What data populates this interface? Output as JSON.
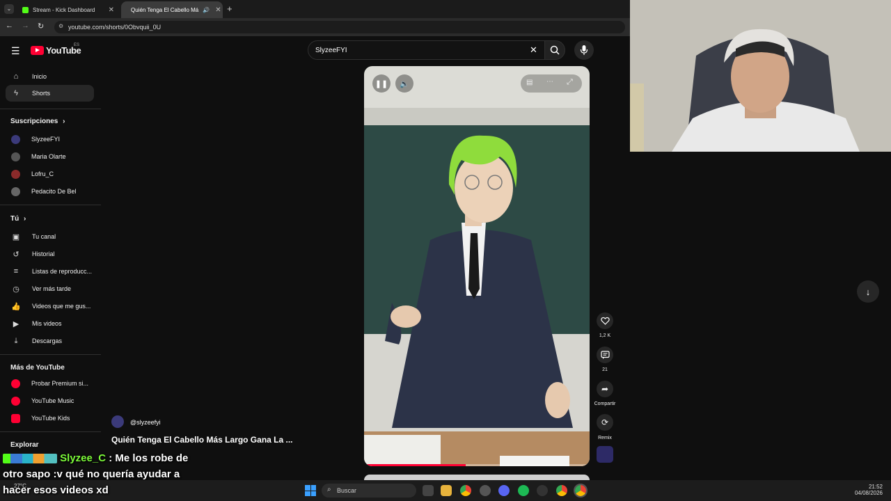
{
  "browser": {
    "tabs": [
      {
        "title": "Stream - Kick Dashboard"
      },
      {
        "title": "Quién Tenga El Cabello Má"
      }
    ],
    "url": "youtube.com/shorts/0Obvquii_0U",
    "new_tab": "+"
  },
  "youtube": {
    "logo": "YouTube",
    "region": "ES",
    "search_value": "SlyzeeFYI"
  },
  "sidebar": {
    "main": [
      {
        "label": "Inicio",
        "icon": "home-icon"
      },
      {
        "label": "Shorts",
        "icon": "shorts-icon"
      }
    ],
    "subs_header": "Suscripciones",
    "subs": [
      {
        "label": "SlyzeeFYI",
        "color": "#3b3a7a"
      },
      {
        "label": "Maria Olarte",
        "color": "#555555"
      },
      {
        "label": "Lofru_C",
        "color": "#8a2a2a"
      },
      {
        "label": "Pedacito De Bel",
        "color": "#666666"
      }
    ],
    "you_header": "Tú",
    "you": [
      {
        "label": "Tu canal",
        "icon": "channel-icon"
      },
      {
        "label": "Historial",
        "icon": "history-icon"
      },
      {
        "label": "Listas de reproducc...",
        "icon": "playlists-icon"
      },
      {
        "label": "Ver más tarde",
        "icon": "watch-later-icon"
      },
      {
        "label": "Videos que me gus...",
        "icon": "like-icon"
      },
      {
        "label": "Mis videos",
        "icon": "my-videos-icon"
      },
      {
        "label": "Descargas",
        "icon": "downloads-icon"
      }
    ],
    "more_header": "Más de YouTube",
    "more": [
      {
        "label": "Probar Premium si..."
      },
      {
        "label": "YouTube Music"
      },
      {
        "label": "YouTube Kids"
      }
    ],
    "explore_header": "Explorar"
  },
  "short": {
    "channel": "@slyzeefyi",
    "title": "Quién Tenga El Cabello Más Largo Gana La ...",
    "progress": 0.45,
    "actions": [
      {
        "label": "1,2 K",
        "icon": "like-icon"
      },
      {
        "label": "21",
        "icon": "comment-icon"
      },
      {
        "label": "Compartir",
        "icon": "share-icon"
      },
      {
        "label": "Remix",
        "icon": "remix-icon"
      }
    ]
  },
  "chat_overlay": {
    "user": "Slyzee_C",
    "line1": ": Me los robe de",
    "line2": "otro sapo :v qué no quería ayudar a",
    "line3": "hacer esos videos xd"
  },
  "taskbar": {
    "search": "Buscar",
    "temp": "27°C",
    "time": "21:52",
    "date": "04/08/2026"
  },
  "colors": {
    "accent_red": "#ff0033",
    "kick_green": "#53fc18",
    "hair_green": "#8fdc3c"
  }
}
